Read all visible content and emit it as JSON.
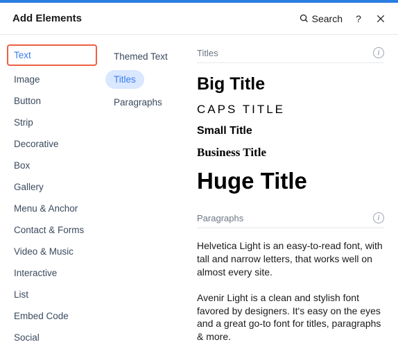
{
  "header": {
    "title": "Add Elements",
    "search_label": "Search",
    "help_label": "?"
  },
  "categories": [
    "Text",
    "Image",
    "Button",
    "Strip",
    "Decorative",
    "Box",
    "Gallery",
    "Menu & Anchor",
    "Contact & Forms",
    "Video & Music",
    "Interactive",
    "List",
    "Embed Code",
    "Social"
  ],
  "subcategories": [
    "Themed Text",
    "Titles",
    "Paragraphs"
  ],
  "sections": {
    "titles": {
      "heading": "Titles",
      "items": {
        "big": "Big Title",
        "caps": "Caps Title",
        "small": "Small Title",
        "business": "Business Title",
        "huge": "Huge Title"
      }
    },
    "paragraphs": {
      "heading": "Paragraphs",
      "items": {
        "p1": "Helvetica Light is an easy-to-read font, with tall and narrow letters, that works well on almost every site.",
        "p2": "Avenir Light is a clean and stylish font favored by designers. It's easy on the eyes and a great go-to font for titles, paragraphs & more."
      }
    }
  }
}
